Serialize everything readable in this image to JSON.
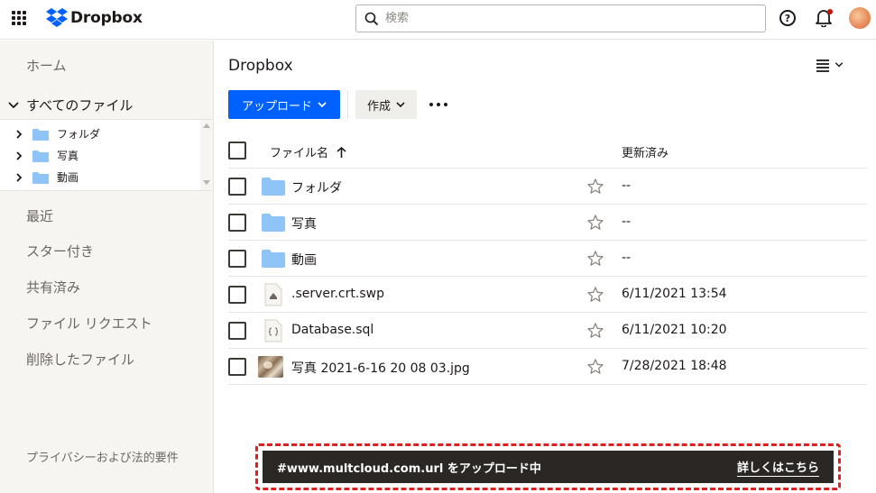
{
  "header": {
    "logo_text": "Dropbox",
    "search_placeholder": "検索",
    "help_label": "?"
  },
  "sidebar": {
    "home": "ホーム",
    "all_files": "すべてのファイル",
    "tree": [
      {
        "label": "フォルダ"
      },
      {
        "label": "写真"
      },
      {
        "label": "動画"
      }
    ],
    "recent": "最近",
    "starred": "スター付き",
    "shared": "共有済み",
    "file_requests": "ファイル リクエスト",
    "deleted": "削除したファイル",
    "privacy": "プライバシーおよび法的要件"
  },
  "main": {
    "title": "Dropbox",
    "upload_label": "アップロード",
    "create_label": "作成",
    "columns": {
      "name": "ファイル名",
      "modified": "更新済み"
    },
    "rows": [
      {
        "name": "フォルダ",
        "modified": "--",
        "type": "folder"
      },
      {
        "name": "写真",
        "modified": "--",
        "type": "folder"
      },
      {
        "name": "動画",
        "modified": "--",
        "type": "folder"
      },
      {
        "name": ".server.crt.swp",
        "modified": "6/11/2021 13:54",
        "type": "file"
      },
      {
        "name": "Database.sql",
        "modified": "6/11/2021 10:20",
        "type": "code"
      },
      {
        "name": "写真 2021-6-16 20 08 03.jpg",
        "modified": "7/28/2021 18:48",
        "type": "image"
      }
    ]
  },
  "toast": {
    "message": "#www.multcloud.com.url をアップロード中",
    "link": "詳しくはこちら"
  },
  "colors": {
    "accent": "#0061fe",
    "folder": "#8fc4f8",
    "toast_bg": "#2b2724",
    "highlight": "#e01e1e"
  }
}
